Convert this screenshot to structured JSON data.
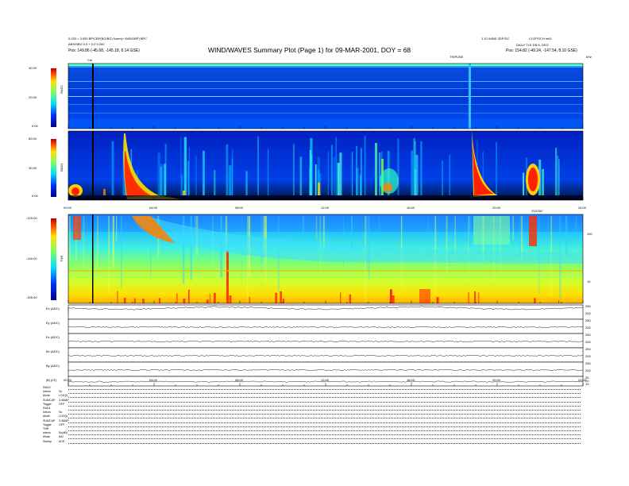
{
  "header": {
    "title": "WIND/WAVES Summary Plot (Page 1) for 09-MAR-2001, DOY = 68",
    "left_line1": "0.033 = 3.000 BP/CBP(BG/BG) Norm(+ AVBG/BP) BPC",
    "left_line2": "ABS/SBG 0.9 + 0.0 0.000",
    "left_pos": "Pos:  149.86 (-45.68, -145.18, 8.14 GSE)",
    "right_line1": "1.10 WIND 3DP/DC",
    "right_line2": "DAILY TLE DB 8, 2002",
    "right_pos": "Pos:  154.82 (-49.24, -147.54, 8.10 GSE)",
    "right_top": "L3 EPOCH  mk3",
    "marker_label": "Cal",
    "mid_label": "TRIPUSE",
    "tnr_right_unit": "kHz",
    "tnr_top_label": "GVC5IC"
  },
  "chart_data": [
    {
      "type": "heatmap",
      "name": "RAD2",
      "ylabel": "RAD2",
      "ylim": [
        0,
        40
      ],
      "yticks": [
        "40.00",
        "20.00",
        "0.00"
      ]
    },
    {
      "type": "heatmap",
      "name": "RAD1",
      "ylabel": "RAD1",
      "ylim": [
        0,
        60
      ],
      "yticks": [
        "60.00",
        "30.00",
        "0.00"
      ],
      "xticks": [
        "00:00",
        "04:00",
        "08:00",
        "12:00",
        "16:00",
        "20:00",
        "24:00"
      ]
    },
    {
      "type": "heatmap",
      "name": "TNR",
      "ylabel": "TNR",
      "yticks": [
        "-125.00",
        "-140.00",
        "-155.00"
      ],
      "right_ticks": [
        "100",
        "10"
      ]
    },
    {
      "type": "line",
      "name": "spin-plane panels",
      "channels": [
        "Ex (ADC)",
        "Ey (ADC)",
        "Ez (ADC)",
        "Bx (ADC)",
        "By (ADC)",
        "|B| (nT)"
      ],
      "right_ticks": [
        [
          "250",
          "200"
        ],
        [
          "250",
          "200"
        ],
        [
          "250",
          "200"
        ],
        [
          "250",
          "200"
        ],
        [
          "250",
          "200"
        ],
        [
          "30",
          "20",
          "10"
        ]
      ],
      "xticks": [
        "00:00",
        "04:00",
        "08:00",
        "12:00",
        "16:00",
        "20:00",
        "24:00"
      ]
    }
  ],
  "info_block": [
    [
      "RAD2",
      ""
    ],
    [
      "Intens.",
      "Sc"
    ],
    [
      "Mode",
      "LOG(I)"
    ],
    [
      "SUMCAP",
      "3.4MAP"
    ],
    [
      "Toggle",
      "OFF"
    ],
    [
      "RAD1",
      ""
    ],
    [
      "Intens.",
      "Sc"
    ],
    [
      "Mode",
      "LOG(I)"
    ],
    [
      "SUMCAP",
      "3.4MAP"
    ],
    [
      "Toggle",
      "OFF"
    ],
    [
      "TNR",
      ""
    ],
    [
      "Intens.",
      "Sc(dB)"
    ],
    [
      "Mode",
      "A/D"
    ],
    [
      "Sweep",
      "ACE"
    ]
  ]
}
